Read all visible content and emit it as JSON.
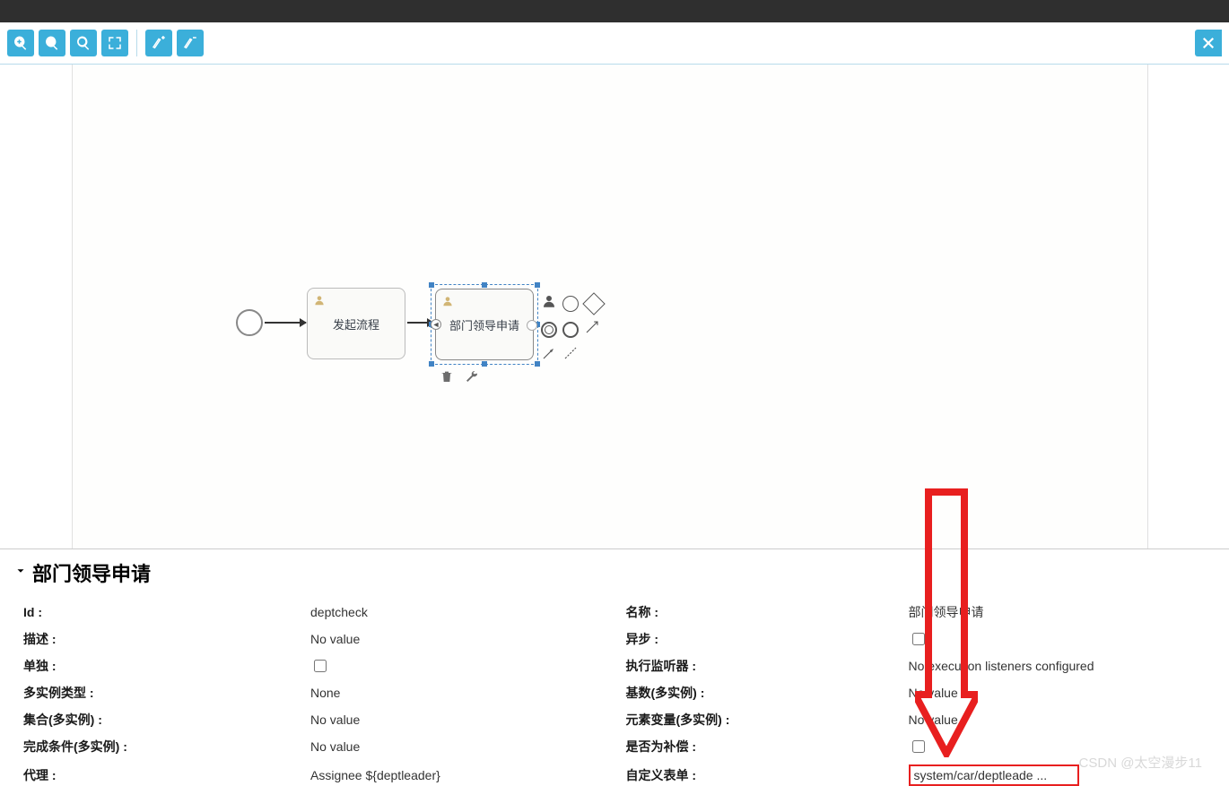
{
  "toolbar": {
    "icons": [
      "zoom-in",
      "zoom-out",
      "zoom-reset",
      "fit-screen",
      "align-h",
      "align-v",
      "close"
    ]
  },
  "diagram": {
    "task1_label": "发起流程",
    "task2_label": "部门领导申请"
  },
  "panel": {
    "title": "部门领导申请",
    "rows": [
      {
        "l1": "Id :",
        "v1": "deptcheck",
        "l2": "名称 :",
        "v2": "部门领导申请"
      },
      {
        "l1": "描述 :",
        "v1": "No value",
        "l2": "异步 :",
        "v2_checkbox": true,
        "v2_checked": false
      },
      {
        "l1": "单独 :",
        "v1_checkbox": true,
        "v1_checked": false,
        "l2": "执行监听器 :",
        "v2": "No execution listeners configured"
      },
      {
        "l1": "多实例类型 :",
        "v1": "None",
        "l2": "基数(多实例) :",
        "v2": "No value"
      },
      {
        "l1": "集合(多实例) :",
        "v1": "No value",
        "l2": "元素变量(多实例) :",
        "v2": "No value"
      },
      {
        "l1": "完成条件(多实例) :",
        "v1": "No value",
        "l2": "是否为补偿 :",
        "v2_checkbox": true,
        "v2_checked": false
      },
      {
        "l1": "代理 :",
        "v1": "Assignee ${deptleader}",
        "l2": "自定义表单 :",
        "v2": "system/car/deptleade ...",
        "v2_highlight": true
      }
    ]
  },
  "watermark": "CSDN @太空漫步11"
}
